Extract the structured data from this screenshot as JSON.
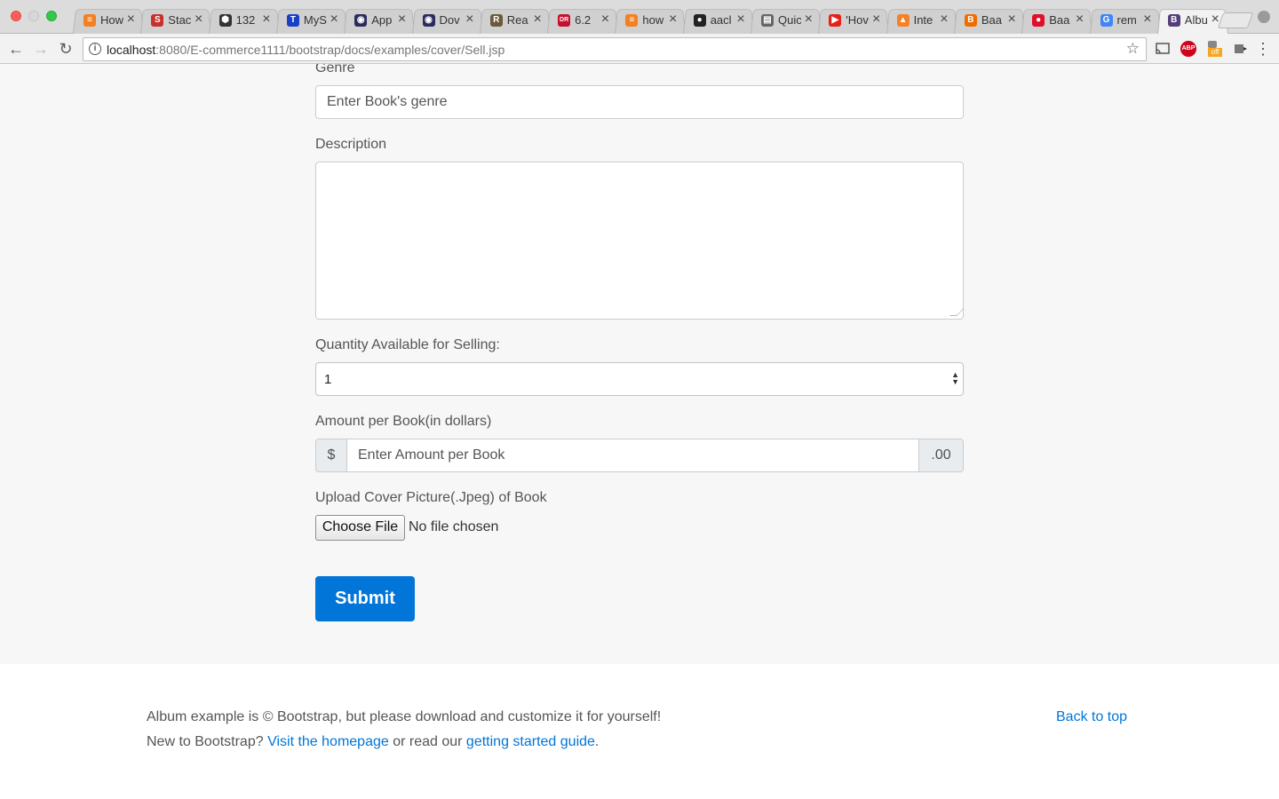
{
  "browser": {
    "tabs": [
      {
        "title": "How",
        "favicon_color": "#f48024",
        "favicon_glyph": "≡"
      },
      {
        "title": "Stac",
        "favicon_color": "#c9302c",
        "favicon_glyph": "S"
      },
      {
        "title": "132",
        "favicon_color": "#333333",
        "favicon_glyph": "⬢"
      },
      {
        "title": "MyS",
        "favicon_color": "#1a3fc7",
        "favicon_glyph": "T"
      },
      {
        "title": "App",
        "favicon_color": "#2b2b5e",
        "favicon_glyph": "◉"
      },
      {
        "title": "Dov",
        "favicon_color": "#2b2b5e",
        "favicon_glyph": "◉"
      },
      {
        "title": "Rea",
        "favicon_color": "#6b5a3a",
        "favicon_glyph": "R"
      },
      {
        "title": "6.2",
        "favicon_color": "#c8102e",
        "favicon_glyph": "DR"
      },
      {
        "title": "how",
        "favicon_color": "#f48024",
        "favicon_glyph": "≡"
      },
      {
        "title": "aacl",
        "favicon_color": "#222222",
        "favicon_glyph": "●"
      },
      {
        "title": "Quic",
        "favicon_color": "#666666",
        "favicon_glyph": "▤"
      },
      {
        "title": "'Hov",
        "favicon_color": "#e62117",
        "favicon_glyph": "▶"
      },
      {
        "title": "Inte",
        "favicon_color": "#f58025",
        "favicon_glyph": "▲"
      },
      {
        "title": "Baa",
        "favicon_color": "#ef6c00",
        "favicon_glyph": "B"
      },
      {
        "title": "Baa",
        "favicon_color": "#e0102a",
        "favicon_glyph": "●"
      },
      {
        "title": "rem",
        "favicon_color": "#4285f4",
        "favicon_glyph": "G"
      },
      {
        "title": "Albu",
        "favicon_color": "#563d7c",
        "favicon_glyph": "B",
        "active": true
      }
    ],
    "close_glyph": "×",
    "back_icon": "←",
    "forward_icon": "→",
    "reload_icon": "↻",
    "url_host": "localhost",
    "url_rest": ":8080/E-commerce1111/bootstrap/docs/examples/cover/Sell.jsp",
    "info_glyph": "i",
    "star_glyph": "☆",
    "extensions": [
      "cast-icon",
      "adblock-icon",
      "off-extension-icon",
      "puzzle-extension-icon",
      "menu-icon"
    ],
    "adblock_text": "ABP",
    "off_text": "off",
    "menu_glyph": "⋮"
  },
  "form": {
    "genre_label": "Genre",
    "genre_placeholder": "Enter Book's genre",
    "description_label": "Description",
    "quantity_label": "Quantity Available for Selling:",
    "quantity_value": "1",
    "amount_label": "Amount per Book(in dollars)",
    "amount_prefix": "$",
    "amount_placeholder": "Enter Amount per Book",
    "amount_suffix": ".00",
    "upload_label": "Upload Cover Picture(.Jpeg) of Book",
    "choose_file_label": "Choose File",
    "no_file_text": "No file chosen",
    "submit_label": "Submit"
  },
  "footer": {
    "line1": "Album example is © Bootstrap, but please download and customize it for yourself!",
    "line2_prefix": "New to Bootstrap? ",
    "homepage_link": "Visit the homepage",
    "line2_mid": " or read our ",
    "guide_link": "getting started guide",
    "line2_suffix": ".",
    "back_to_top": "Back to top"
  }
}
